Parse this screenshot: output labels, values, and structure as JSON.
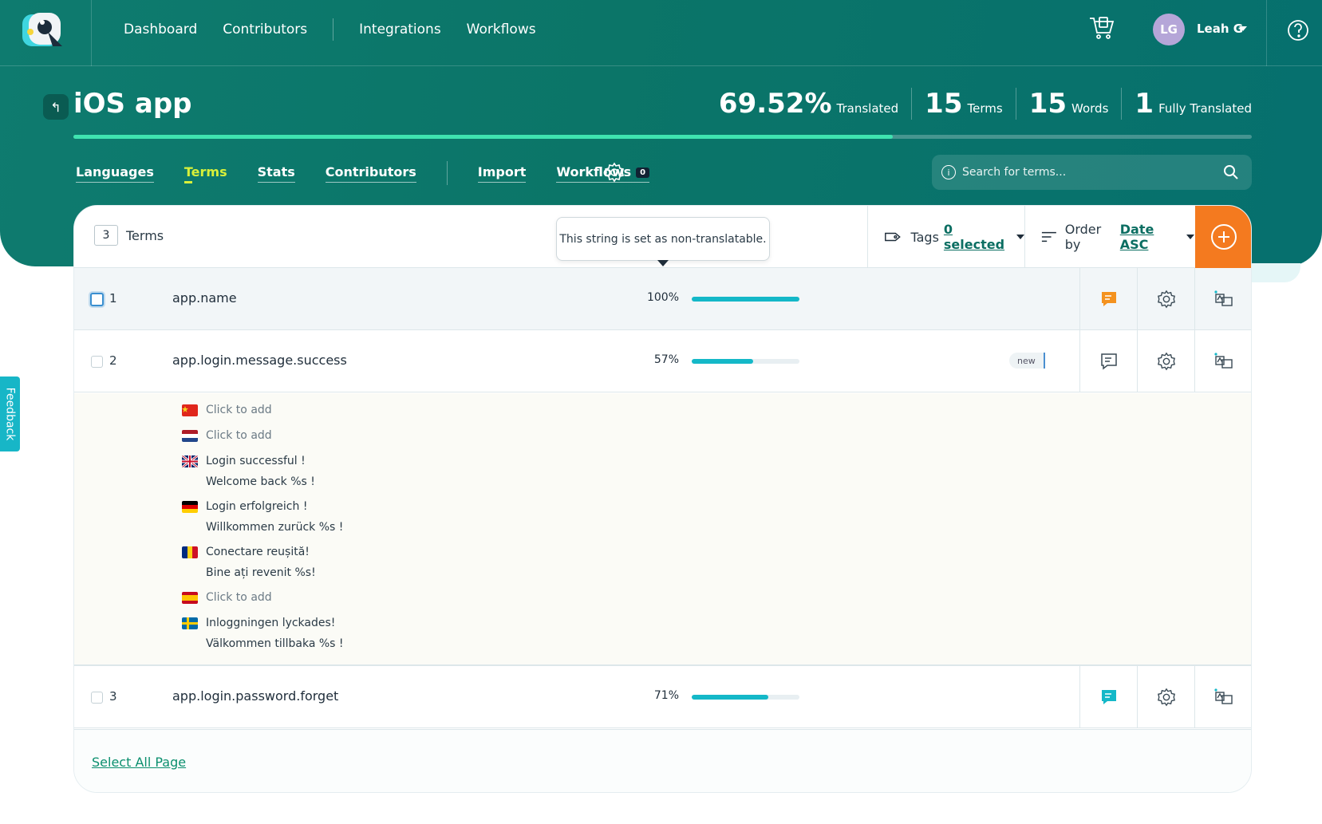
{
  "nav": {
    "items": [
      "Dashboard",
      "Contributors",
      "Integrations",
      "Workflows"
    ],
    "user_initials": "LG",
    "user_name": "Leah G"
  },
  "project": {
    "title": "iOS app",
    "stats": [
      {
        "value": "69.52%",
        "label": "Translated"
      },
      {
        "value": "15",
        "label": "Terms"
      },
      {
        "value": "15",
        "label": "Words"
      },
      {
        "value": "1",
        "label": "Fully Translated"
      }
    ],
    "progress_fraction": 0.6952
  },
  "subnav": {
    "tabs": [
      "Languages",
      "Terms",
      "Stats",
      "Contributors"
    ],
    "active_tab": "Terms",
    "import": "Import",
    "workflows": "Workflows",
    "workflows_count": "0"
  },
  "search": {
    "placeholder": "Search for terms..."
  },
  "card": {
    "count": "3",
    "count_label": "Terms",
    "tooltip": "This string is set as non-translatable.",
    "tags_label": "Tags",
    "tags_value": "0 selected",
    "order_label": "Order by",
    "order_value": "Date ASC",
    "select_all": "Select All Page"
  },
  "rows": [
    {
      "index": "1",
      "key": "app.name",
      "percent": "100%",
      "fraction": 1.0
    },
    {
      "index": "2",
      "key": "app.login.message.success",
      "percent": "57%",
      "fraction": 0.57,
      "tag": "new"
    },
    {
      "index": "3",
      "key": "app.login.password.forget",
      "percent": "71%",
      "fraction": 0.71
    }
  ],
  "translations": [
    {
      "flag": "cn-flag-icon",
      "line1": "Click to add",
      "line2": "",
      "placeholder": true
    },
    {
      "flag": "nl-flag-icon",
      "line1": "Click to add",
      "line2": "",
      "placeholder": true
    },
    {
      "flag": "gb-flag-icon",
      "line1": "Login successful !",
      "line2": "Welcome back %s !",
      "placeholder": false
    },
    {
      "flag": "de-flag-icon",
      "line1": "Login erfolgreich !",
      "line2": "Willkommen zurück %s !",
      "placeholder": false
    },
    {
      "flag": "ro-flag-icon",
      "line1": "Conectare reușită!",
      "line2": "Bine ați revenit %s!",
      "placeholder": false
    },
    {
      "flag": "es-flag-icon",
      "line1": "Click to add",
      "line2": "",
      "placeholder": true
    },
    {
      "flag": "se-flag-icon",
      "line1": "Inloggningen lyckades!",
      "line2": "Välkommen tillbaka %s !",
      "placeholder": false
    }
  ],
  "feedback": "Feedback",
  "colors": {
    "accent": "#0b7568",
    "orange": "#f47a1f",
    "progress": "#14b8c8"
  }
}
